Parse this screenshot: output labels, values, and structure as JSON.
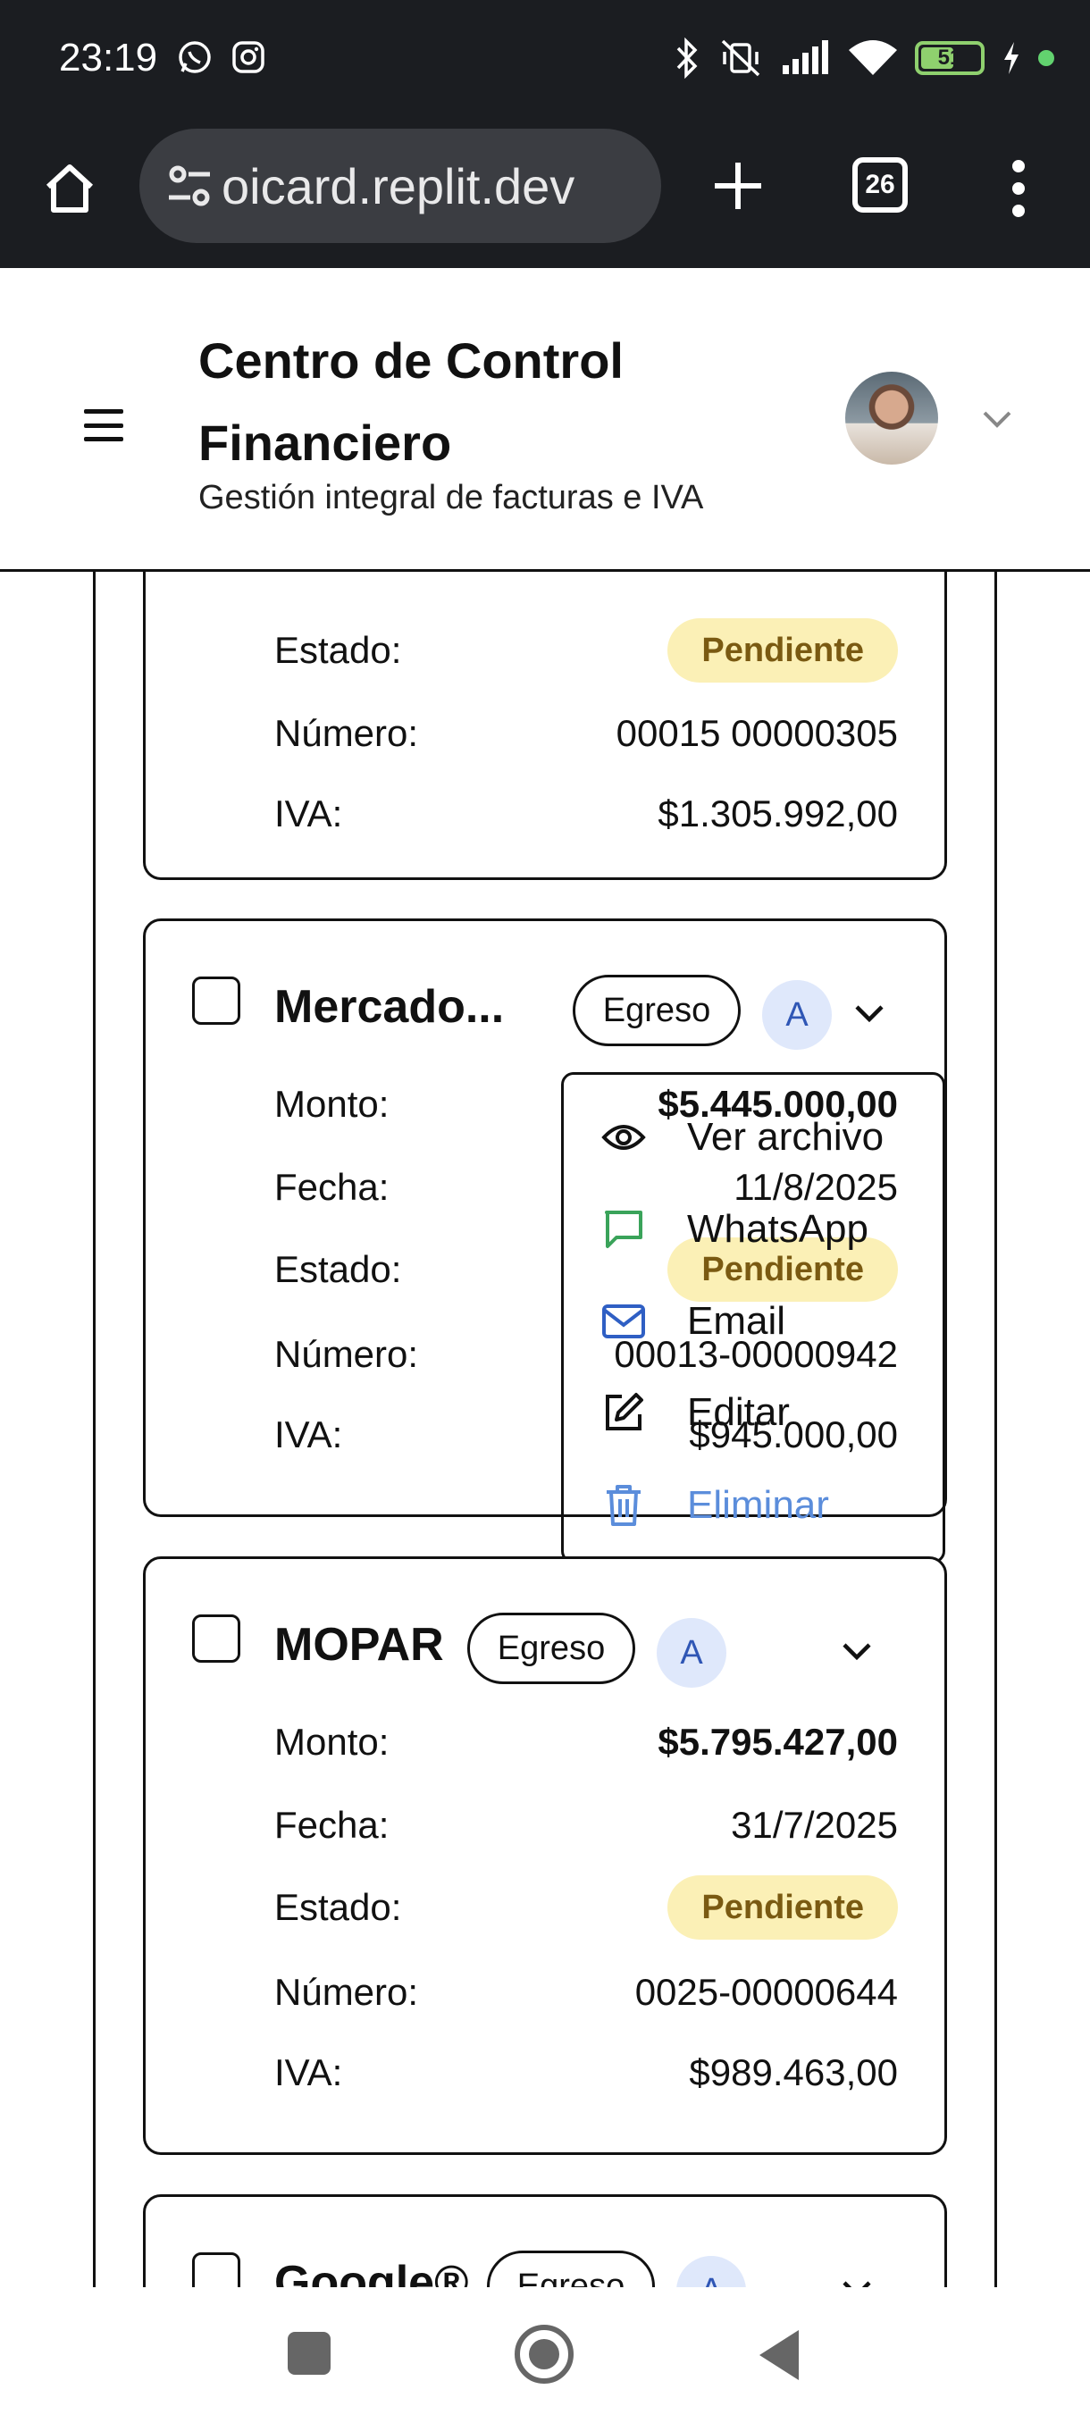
{
  "status_bar": {
    "time": "23:19",
    "notification_icons": [
      "whatsapp-icon",
      "instagram-icon"
    ],
    "system_icons": [
      "bluetooth-icon",
      "vibrate-off-icon",
      "signal-icon",
      "wifi-icon"
    ],
    "battery_level": "51",
    "battery_color": "#8fd06e",
    "charging": true
  },
  "browser": {
    "url": "oicard.replit.dev",
    "tab_count": "26"
  },
  "header": {
    "title": "Centro de Control Financiero",
    "subtitle": "Gestión integral de facturas e IVA"
  },
  "labels": {
    "amount": "Monto:",
    "date": "Fecha:",
    "status": "Estado:",
    "number": "Número:",
    "vat": "IVA:"
  },
  "invoices": [
    {
      "name": "",
      "status": "Pendiente",
      "number": "00015 00000305",
      "vat": "$1.305.992,00"
    },
    {
      "name": "Mercado...",
      "type": "Egreso",
      "category": "A",
      "amount": "$5.445.000,00",
      "date": "11/8/2025",
      "status": "Pendiente",
      "number": "00013-00000942",
      "vat": "$945.000,00"
    },
    {
      "name": "MOPAR",
      "type": "Egreso",
      "category": "A",
      "amount": "$5.795.427,00",
      "date": "31/7/2025",
      "status": "Pendiente",
      "number": "0025-00000644",
      "vat": "$989.463,00"
    },
    {
      "name": "Google®",
      "type": "Egreso",
      "category": "A"
    }
  ],
  "action_menu": {
    "items": [
      {
        "label": "Ver archivo",
        "icon": "eye-icon"
      },
      {
        "label": "WhatsApp",
        "icon": "message-icon"
      },
      {
        "label": "Email",
        "icon": "mail-icon"
      },
      {
        "label": "Editar",
        "icon": "edit-icon"
      },
      {
        "label": "Eliminar",
        "icon": "trash-icon"
      }
    ]
  },
  "colors": {
    "pending_badge_bg": "#fbf0b6",
    "pending_badge_text": "#7a5a12",
    "category_bg": "#dfe8fb",
    "category_text": "#2f56b5",
    "whatsapp_green": "#3aa35a",
    "email_blue": "#2f5fc4",
    "delete_blue": "#5b8ddb"
  }
}
